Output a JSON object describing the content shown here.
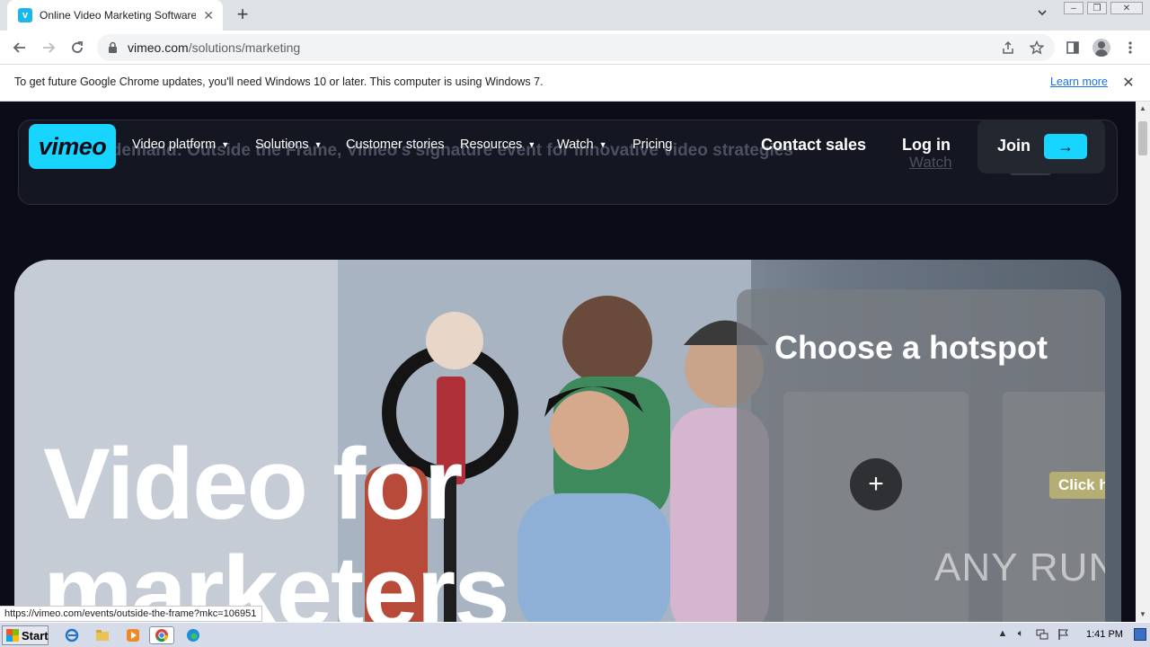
{
  "browser": {
    "tab_title": "Online Video Marketing Software and",
    "favicon_letter": "v",
    "new_tab_label": "+",
    "url_host": "vimeo.com",
    "url_path": "/solutions/marketing"
  },
  "infobar": {
    "message": "To get future Google Chrome updates, you'll need Windows 10 or later. This computer is using Windows 7.",
    "link": "Learn more"
  },
  "banner": {
    "text": "able on demand: Outside the Frame, Vimeo's signature event for innovative video strategies",
    "watch": "Watch"
  },
  "nav": {
    "logo": "vimeo",
    "items": [
      {
        "label": "Video platform",
        "dropdown": true
      },
      {
        "label": "Solutions",
        "dropdown": true
      },
      {
        "label": "Customer stories",
        "dropdown": false
      },
      {
        "label": "Resources",
        "dropdown": true
      },
      {
        "label": "Watch",
        "dropdown": true
      },
      {
        "label": "Pricing",
        "dropdown": false
      }
    ],
    "contact_sales": "Contact sales",
    "log_in": "Log in",
    "join": "Join",
    "accent_color": "#17d5ff"
  },
  "hero": {
    "title_line1": "Video for",
    "title_line2": "marketers",
    "hotspot_title": "Choose a hotspot",
    "plus": "+",
    "click_label": "Click h",
    "watermark": "ANY RUN"
  },
  "status_url": "https://vimeo.com/events/outside-the-frame?mkc=106951",
  "taskbar": {
    "start": "Start",
    "clock": "1:41 PM"
  }
}
